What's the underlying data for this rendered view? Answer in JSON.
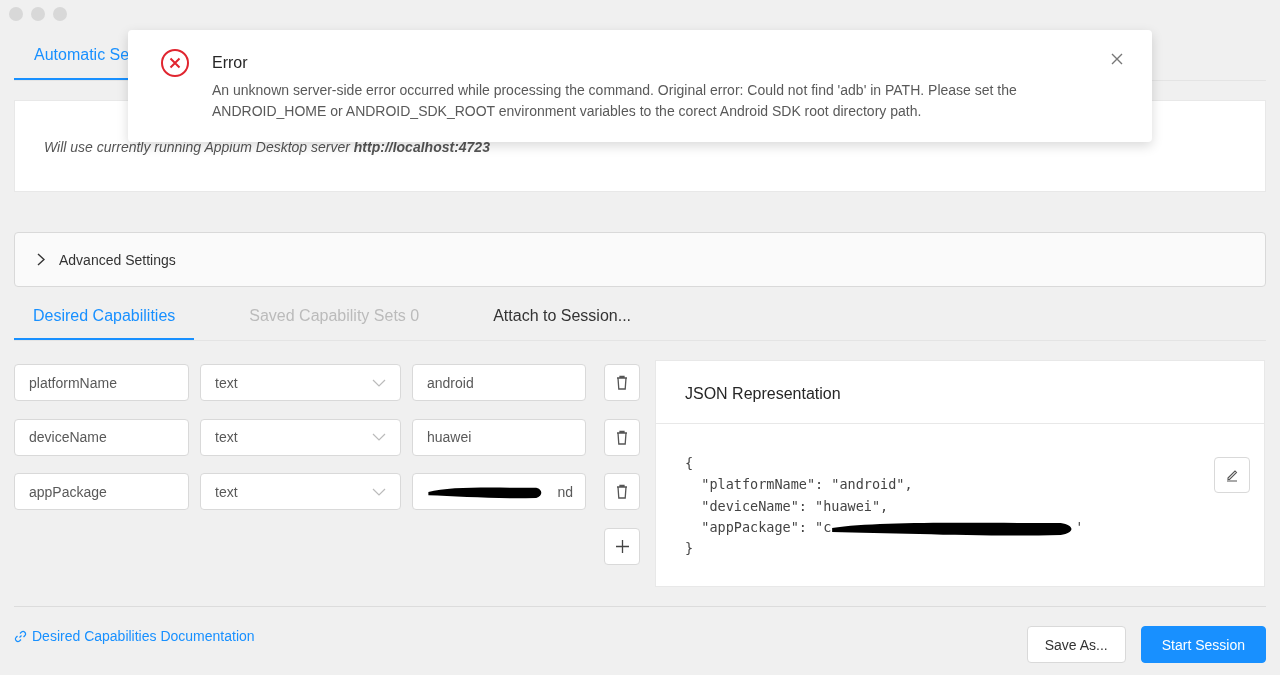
{
  "server_tabs": [
    {
      "label": "Automatic Se",
      "selected": true
    }
  ],
  "server_card": {
    "text": "Will use currently running Appium Desktop server **http://localhost:4723**"
  },
  "advanced_settings": {
    "label": "Advanced Settings",
    "expanded": false
  },
  "capability_tabs": [
    {
      "label": "Desired Capabilities",
      "selected": true,
      "disabled": false
    },
    {
      "label": "Saved Capability Sets 0",
      "selected": false,
      "disabled": true
    },
    {
      "label": "Attach to Session...",
      "selected": false,
      "disabled": false
    }
  ],
  "capabilities": [
    {
      "name": "platformName",
      "type": "text",
      "value": "android",
      "redacted": false
    },
    {
      "name": "deviceName",
      "type": "text",
      "value": "huawei",
      "redacted": false
    },
    {
      "name": "appPackage",
      "type": "text",
      "value": "nd",
      "redacted": true
    }
  ],
  "json_panel": {
    "title": "JSON Representation",
    "lines": [
      {
        "text": "{",
        "redacted": false
      },
      {
        "text": "  \"platformName\": \"android\",",
        "redacted": false
      },
      {
        "text": "  \"deviceName\": \"huawei\",",
        "redacted": false
      },
      {
        "text": "  \"appPackage\": \"c",
        "redacted": true,
        "tail": "'"
      },
      {
        "text": "}",
        "redacted": false
      }
    ]
  },
  "footer": {
    "link": "Desired Capabilities Documentation",
    "buttons": [
      {
        "label": "Save As...",
        "primary": false
      },
      {
        "label": "Start Session",
        "primary": true
      }
    ]
  },
  "error_toast": {
    "title": "Error",
    "message": "An unknown server-side error occurred while processing the command. Original error: Could not find 'adb' in PATH. Please set the ANDROID_HOME or ANDROID_SDK_ROOT environment variables to the corect Android SDK root directory path."
  }
}
